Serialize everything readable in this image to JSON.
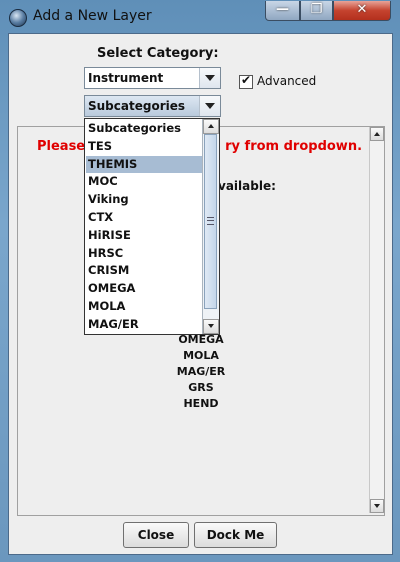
{
  "window": {
    "title": "Add a New Layer",
    "minimize_glyph": "—",
    "maximize_glyph": "❐",
    "close_glyph": "✕"
  },
  "form": {
    "category_label": "Select Category:",
    "category_value": "Instrument",
    "subcategory_value": "Subcategories",
    "advanced_label": "Advanced",
    "advanced_checked_glyph": "✔"
  },
  "panel": {
    "prompt": "Please ........................ry from dropdown.",
    "prompt_left": "Please",
    "prompt_right": "ry from dropdown.",
    "available_suffix": "vailable:",
    "items": [
      "OMEGA",
      "MOLA",
      "MAG/ER",
      "GRS",
      "HEND"
    ]
  },
  "dropdown": {
    "items": [
      "Subcategories",
      "TES",
      "THEMIS",
      "MOC",
      "Viking",
      "CTX",
      "HiRISE",
      "HRSC",
      "CRISM",
      "OMEGA",
      "MOLA",
      "MAG/ER"
    ],
    "selected": "THEMIS"
  },
  "buttons": {
    "close": "Close",
    "dock": "Dock Me"
  },
  "colors": {
    "prompt": "#e00000",
    "selection": "#a7bcd3",
    "close_button": "#c5432f"
  },
  "icons": {
    "app": "globe-icon",
    "checkbox": "checkmark-icon"
  }
}
